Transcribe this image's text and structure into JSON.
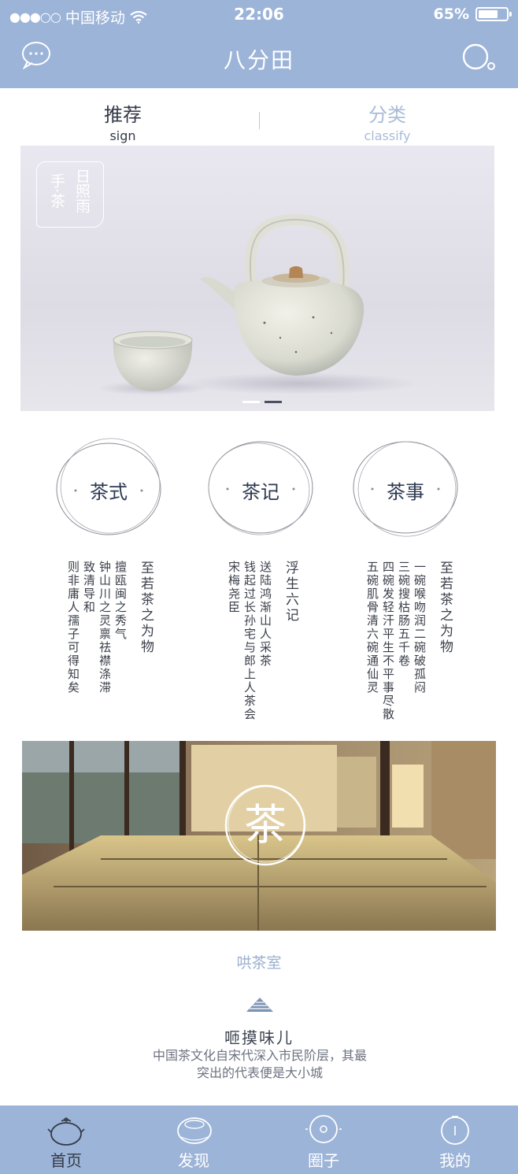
{
  "status_bar": {
    "carrier": "中国移动",
    "time": "22:06",
    "battery": "65%"
  },
  "header": {
    "title": "八分田",
    "left_icon": "message-icon",
    "right_icon": "search-icon"
  },
  "tabs": [
    {
      "label": "推荐",
      "sub": "sign",
      "active": true
    },
    {
      "label": "分类",
      "sub": "classify",
      "active": false
    }
  ],
  "banner": {
    "seal_columns": [
      "日照雨",
      "手·茶"
    ],
    "slide_index": 2,
    "slide_count": 2
  },
  "categories": [
    {
      "label": "茶式"
    },
    {
      "label": "茶记"
    },
    {
      "label": "茶事"
    }
  ],
  "poems": [
    {
      "title": "至若茶之为物",
      "lines": [
        "擅瓯闽之秀气",
        "钟山川之灵禀祛襟涤滞",
        "致清导和",
        "则非庸人孺子可得知矣"
      ]
    },
    {
      "title": "浮生六记",
      "lines": [
        "送陆鸿渐山人采茶",
        "钱起过长孙宅与郎上人茶会",
        "宋梅尧臣"
      ]
    },
    {
      "title": "至若茶之为物",
      "lines": [
        "一碗喉吻润二碗破孤闷",
        "三碗搜枯肠五千卷",
        "四碗发轻汗平生不平事尽散",
        "五碗肌骨清六碗通仙灵"
      ]
    }
  ],
  "tearoom": {
    "emblem_char": "茶",
    "name": "哄茶室"
  },
  "article": {
    "icon": "mountain-icon",
    "title": "咂摸味儿",
    "desc_line1": "中国茶文化自宋代深入市民阶层，其最",
    "desc_line2": "突出的代表便是大小城"
  },
  "bottom_nav": [
    {
      "label": "首页",
      "icon": "teapot-icon",
      "active": true
    },
    {
      "label": "发现",
      "icon": "discover-icon",
      "active": false
    },
    {
      "label": "圈子",
      "icon": "circle-icon",
      "active": false
    },
    {
      "label": "我的",
      "icon": "profile-icon",
      "active": false
    }
  ],
  "colors": {
    "brand": "#9cb4d8",
    "accent_text": "#a9bbd8",
    "dark_text": "#333a46"
  }
}
